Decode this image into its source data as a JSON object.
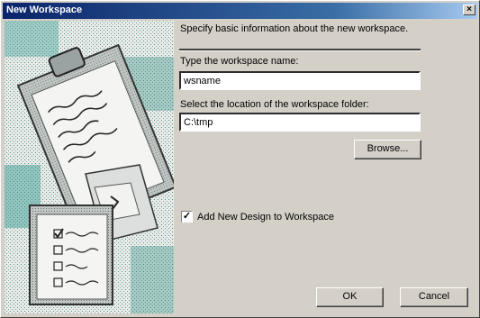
{
  "window": {
    "title": "New Workspace",
    "close_symbol": "×"
  },
  "intro": "Specify basic information about the new workspace.",
  "name_field": {
    "label": "Type the workspace name:",
    "value": "wsname"
  },
  "location_field": {
    "label": "Select the location of the workspace folder:",
    "value": "C:\\tmp"
  },
  "browse_label": "Browse...",
  "checkbox": {
    "label": "Add New Design to Workspace",
    "checked": true,
    "mark": "✓"
  },
  "ok_label": "OK",
  "cancel_label": "Cancel",
  "icons": {
    "art": "clipboard-illustration"
  }
}
